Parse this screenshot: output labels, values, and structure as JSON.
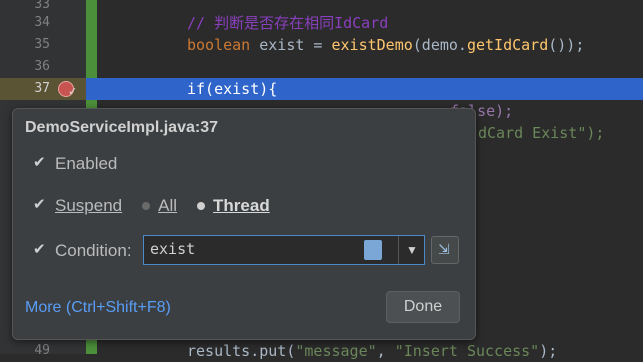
{
  "editor": {
    "lines": [
      {
        "num": "33",
        "code": ""
      },
      {
        "num": "34",
        "comment": "// 判断是否存在相同IdCard"
      },
      {
        "num": "35",
        "kw": "boolean",
        "rest1": " exist = ",
        "call1": "existDemo",
        "rest2": "(demo.",
        "call2": "getIdCard",
        "rest3": "());"
      },
      {
        "num": "36",
        "code": ""
      },
      {
        "num": "37",
        "code": "if(exist){"
      },
      {
        "num": "49",
        "code_a": "results.put(",
        "str_a": "\"message\"",
        "code_b": ", ",
        "str_b": "\"Insert Success\"",
        "code_c": ");"
      }
    ],
    "behind": {
      "line38_tail": "false);",
      "line39_tail": "dCard Exist\");",
      "line_paren": "(",
      "semicolon": ";"
    }
  },
  "popup": {
    "title": "DemoServiceImpl.java:37",
    "enabled_label": "Enabled",
    "suspend_label": "Suspend",
    "all_label": "All",
    "thread_label": "Thread",
    "condition_label": "Condition:",
    "condition_value": "exist",
    "more_link": "More (Ctrl+Shift+F8)",
    "done_label": "Done"
  },
  "colors": {
    "highlight": "#2f65ca",
    "link": "#589df6",
    "breakpoint": "#c75450"
  }
}
